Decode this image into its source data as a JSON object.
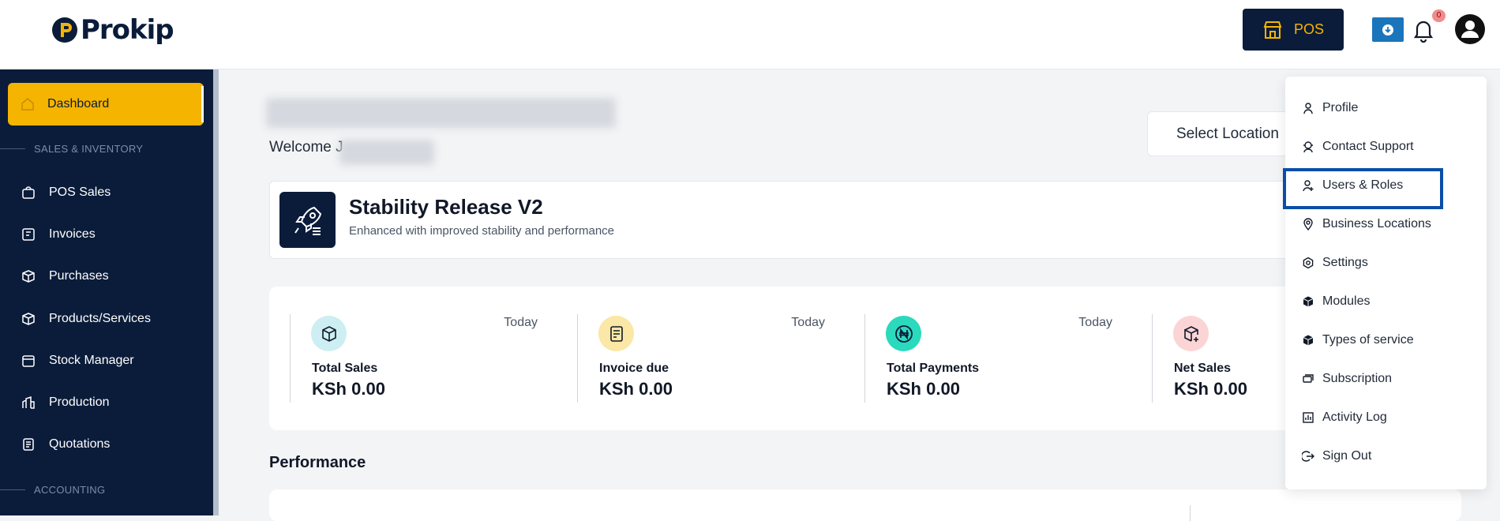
{
  "header": {
    "logo_text": "Prokip",
    "pos_label": "POS",
    "notification_count": "0"
  },
  "sidebar": {
    "active_item": "Dashboard",
    "sections": [
      "SALES & INVENTORY",
      "ACCOUNTING"
    ],
    "items": [
      {
        "label": "POS Sales",
        "icon": "shopping-bag-icon"
      },
      {
        "label": "Invoices",
        "icon": "invoice-icon"
      },
      {
        "label": "Purchases",
        "icon": "purchases-icon"
      },
      {
        "label": "Products/Services",
        "icon": "box-icon"
      },
      {
        "label": "Stock Manager",
        "icon": "stock-icon"
      },
      {
        "label": "Production",
        "icon": "production-icon"
      },
      {
        "label": "Quotations",
        "icon": "quotation-icon"
      }
    ]
  },
  "main": {
    "welcome": "Welcome J",
    "select_location": "Select Location",
    "release": {
      "title": "Stability Release V2",
      "subtitle": "Enhanced with improved stability and performance"
    },
    "stats": [
      {
        "label": "Total Sales",
        "value": "KSh 0.00",
        "period": "Today",
        "icon": "package-icon",
        "color": "#cdeef2"
      },
      {
        "label": "Invoice due",
        "value": "KSh 0.00",
        "period": "Today",
        "icon": "receipt-icon",
        "color": "#fbe7a6"
      },
      {
        "label": "Total Payments",
        "value": "KSh 0.00",
        "period": "Today",
        "icon": "naira-icon",
        "color": "#2bd9bd"
      },
      {
        "label": "Net Sales",
        "value": "KSh 0.00",
        "period": "",
        "icon": "package-plus-icon",
        "color": "#fbd5d5"
      }
    ],
    "performance_title": "Performance"
  },
  "dropdown": {
    "highlighted": "Users & Roles",
    "items": [
      {
        "label": "Profile",
        "icon": "user-icon"
      },
      {
        "label": "Contact Support",
        "icon": "support-icon"
      },
      {
        "label": "Users & Roles",
        "icon": "user-plus-icon"
      },
      {
        "label": "Business Locations",
        "icon": "location-icon"
      },
      {
        "label": "Settings",
        "icon": "settings-icon"
      },
      {
        "label": "Modules",
        "icon": "cube-icon"
      },
      {
        "label": "Types of service",
        "icon": "cube-icon"
      },
      {
        "label": "Subscription",
        "icon": "subscription-icon"
      },
      {
        "label": "Activity Log",
        "icon": "chart-icon"
      },
      {
        "label": "Sign Out",
        "icon": "sign-out-icon"
      }
    ]
  },
  "colors": {
    "navy": "#0b1c3a",
    "accent": "#f5b400",
    "highlight_border": "#0a4ea8"
  }
}
